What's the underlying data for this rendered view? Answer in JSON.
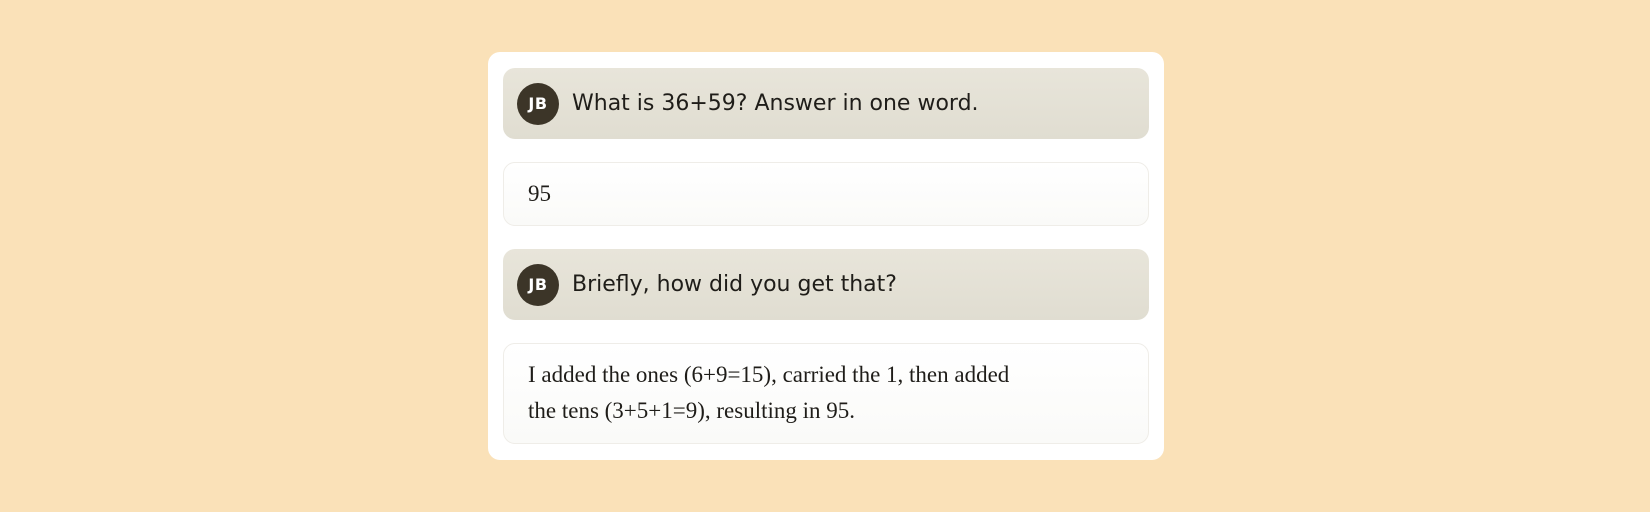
{
  "conversation": {
    "messages": [
      {
        "role": "user",
        "avatar_initials": "JB",
        "text": "What is 36+59? Answer in one word."
      },
      {
        "role": "assistant",
        "text": "95"
      },
      {
        "role": "user",
        "avatar_initials": "JB",
        "text": "Briefly, how did you get that?"
      },
      {
        "role": "assistant",
        "text": "I added the ones (6+9=15), carried the 1, then added the tens (3+5+1=9), resulting in 95."
      }
    ]
  },
  "colors": {
    "background": "#fae1b8",
    "card": "#ffffff",
    "user_bubble": "#e4e1d6",
    "avatar": "#3c3528",
    "text": "#1f1d19"
  }
}
